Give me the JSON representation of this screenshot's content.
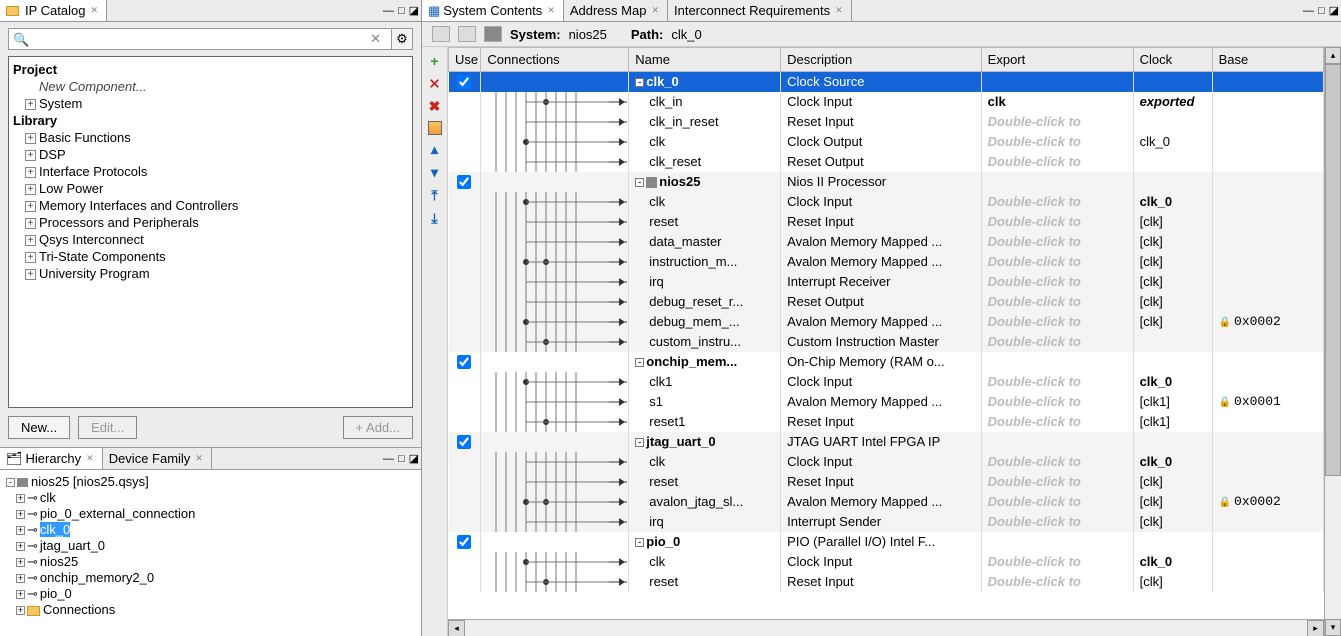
{
  "leftTabs": {
    "ipCatalog": "IP Catalog"
  },
  "searchPlaceholder": "🔍",
  "projectLabel": "Project",
  "newComponent": "New Component...",
  "systemLabel": "System",
  "libraryLabel": "Library",
  "libItems": [
    "Basic Functions",
    "DSP",
    "Interface Protocols",
    "Low Power",
    "Memory Interfaces and Controllers",
    "Processors and Peripherals",
    "Qsys Interconnect",
    "Tri-State Components",
    "University Program"
  ],
  "buttons": {
    "new": "New...",
    "edit": "Edit...",
    "add": "+  Add..."
  },
  "hierTabs": {
    "hierarchy": "Hierarchy",
    "deviceFamily": "Device Family"
  },
  "hierRoot": "nios25  [nios25.qsys]",
  "hierItems": [
    "clk",
    "pio_0_external_connection",
    "clk_0",
    "jtag_uart_0",
    "nios25",
    "onchip_memory2_0",
    "pio_0",
    "Connections"
  ],
  "hierSelected": "clk_0",
  "rightTabs": {
    "sysContents": "System Contents",
    "addrMap": "Address Map",
    "interconnect": "Interconnect Requirements"
  },
  "sysToolbar": {
    "systemLabel": "System:",
    "systemName": "nios25",
    "pathLabel": "Path:",
    "pathValue": "clk_0"
  },
  "headers": {
    "use": "Use",
    "connections": "Connections",
    "name": "Name",
    "description": "Description",
    "export": "Export",
    "clock": "Clock",
    "base": "Base"
  },
  "dblClick": "Double-click to",
  "rows": [
    {
      "type": "comp",
      "use": true,
      "name": "clk_0",
      "desc": "Clock Source",
      "export": "",
      "clock": "",
      "base": "",
      "selected": true
    },
    {
      "type": "if",
      "name": "clk_in",
      "desc": "Clock Input",
      "export": "clk",
      "clock": "exported",
      "clockItalic": true,
      "base": ""
    },
    {
      "type": "if",
      "name": "clk_in_reset",
      "desc": "Reset Input",
      "exportPh": true,
      "clock": "",
      "base": ""
    },
    {
      "type": "if",
      "name": "clk",
      "desc": "Clock Output",
      "exportPh": true,
      "clock": "clk_0",
      "base": ""
    },
    {
      "type": "if",
      "name": "clk_reset",
      "desc": "Reset Output",
      "exportPh": true,
      "clock": "",
      "base": ""
    },
    {
      "type": "comp",
      "use": true,
      "name": "nios25",
      "desc": "Nios II Processor",
      "export": "",
      "clock": "",
      "base": "",
      "alt": true,
      "chip": true
    },
    {
      "type": "if",
      "name": "clk",
      "desc": "Clock Input",
      "exportPh": true,
      "clock": "clk_0",
      "clockBold": true,
      "base": "",
      "alt": true
    },
    {
      "type": "if",
      "name": "reset",
      "desc": "Reset Input",
      "exportPh": true,
      "clock": "[clk]",
      "base": "",
      "alt": true
    },
    {
      "type": "if",
      "name": "data_master",
      "desc": "Avalon Memory Mapped ...",
      "exportPh": true,
      "clock": "[clk]",
      "base": "",
      "alt": true
    },
    {
      "type": "if",
      "name": "instruction_m...",
      "desc": "Avalon Memory Mapped ...",
      "exportPh": true,
      "clock": "[clk]",
      "base": "",
      "alt": true
    },
    {
      "type": "if",
      "name": "irq",
      "desc": "Interrupt Receiver",
      "exportPh": true,
      "clock": "[clk]",
      "base": "",
      "alt": true
    },
    {
      "type": "if",
      "name": "debug_reset_r...",
      "desc": "Reset Output",
      "exportPh": true,
      "clock": "[clk]",
      "base": "",
      "alt": true
    },
    {
      "type": "if",
      "name": "debug_mem_...",
      "desc": "Avalon Memory Mapped ...",
      "exportPh": true,
      "clock": "[clk]",
      "base": "0x0002",
      "alt": true,
      "lock": true
    },
    {
      "type": "if",
      "name": "custom_instru...",
      "desc": "Custom Instruction Master",
      "exportPh": true,
      "clock": "",
      "base": "",
      "alt": true
    },
    {
      "type": "comp",
      "use": true,
      "name": "onchip_mem...",
      "desc": "On-Chip Memory (RAM o...",
      "export": "",
      "clock": "",
      "base": ""
    },
    {
      "type": "if",
      "name": "clk1",
      "desc": "Clock Input",
      "exportPh": true,
      "clock": "clk_0",
      "clockBold": true,
      "base": ""
    },
    {
      "type": "if",
      "name": "s1",
      "desc": "Avalon Memory Mapped ...",
      "exportPh": true,
      "clock": "[clk1]",
      "base": "0x0001",
      "lock": true
    },
    {
      "type": "if",
      "name": "reset1",
      "desc": "Reset Input",
      "exportPh": true,
      "clock": "[clk1]",
      "base": ""
    },
    {
      "type": "comp",
      "use": true,
      "name": "jtag_uart_0",
      "desc": "JTAG UART Intel FPGA IP",
      "export": "",
      "clock": "",
      "base": "",
      "alt": true
    },
    {
      "type": "if",
      "name": "clk",
      "desc": "Clock Input",
      "exportPh": true,
      "clock": "clk_0",
      "clockBold": true,
      "base": "",
      "alt": true
    },
    {
      "type": "if",
      "name": "reset",
      "desc": "Reset Input",
      "exportPh": true,
      "clock": "[clk]",
      "base": "",
      "alt": true
    },
    {
      "type": "if",
      "name": "avalon_jtag_sl...",
      "desc": "Avalon Memory Mapped ...",
      "exportPh": true,
      "clock": "[clk]",
      "base": "0x0002",
      "alt": true,
      "lock": true
    },
    {
      "type": "if",
      "name": "irq",
      "desc": "Interrupt Sender",
      "exportPh": true,
      "clock": "[clk]",
      "base": "",
      "alt": true
    },
    {
      "type": "comp",
      "use": true,
      "name": "pio_0",
      "desc": "PIO (Parallel I/O) Intel F...",
      "export": "",
      "clock": "",
      "base": ""
    },
    {
      "type": "if",
      "name": "clk",
      "desc": "Clock Input",
      "exportPh": true,
      "clock": "clk_0",
      "clockBold": true,
      "base": ""
    },
    {
      "type": "if",
      "name": "reset",
      "desc": "Reset Input",
      "exportPh": true,
      "clock": "[clk]",
      "base": ""
    }
  ]
}
